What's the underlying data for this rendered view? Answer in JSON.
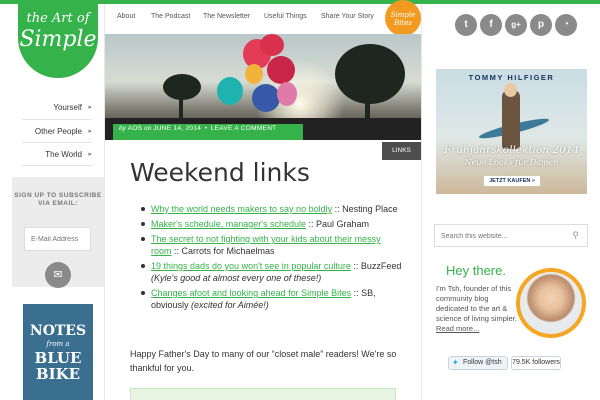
{
  "logo": {
    "line1": "the Art of",
    "line2": "Simple"
  },
  "left_nav": [
    {
      "label": "Yourself"
    },
    {
      "label": "Other People"
    },
    {
      "label": "The World"
    }
  ],
  "subscribe": {
    "title": "SIGN UP TO SUBSCRIBE VIA EMAIL:",
    "placeholder": "E-Mail Address"
  },
  "book": {
    "line1": "NOTES",
    "line2": "from a",
    "line3": "BLUE",
    "line4": "BIKE"
  },
  "top_nav": [
    {
      "label": "About"
    },
    {
      "label": "The Podcast"
    },
    {
      "label": "The Newsletter"
    },
    {
      "label": "Useful Things"
    },
    {
      "label": "Share Your Story"
    }
  ],
  "badge": {
    "line1": "Simple",
    "line2": "Bites"
  },
  "post": {
    "byline_prefix": "by",
    "author": "AOS",
    "date_prefix": "on",
    "date": "JUNE 14, 2014",
    "comment_link": "LEAVE A COMMENT",
    "category": "LINKS",
    "title": "Weekend links",
    "links": [
      {
        "link": "Why the world needs makers to say no boldly",
        "suffix": " :: Nesting Place",
        "note": ""
      },
      {
        "link": "Maker's schedule, manager's schedule",
        "suffix": " :: Paul Graham",
        "note": ""
      },
      {
        "link": "The secret to not fighting with your kids about their messy room",
        "suffix": " :: Carrots for Michaelmas",
        "note": ""
      },
      {
        "link": "19 things dads do you won't see in popular culture",
        "suffix": " :: BuzzFeed ",
        "note": "(Kyle's good at almost every one of these!)"
      },
      {
        "link": "Changes afoot and looking ahead for Simple Bites",
        "suffix": " :: SB, obviously ",
        "note": "(excited for Aimée!)"
      }
    ],
    "paragraph": "Happy Father's Day to many of our “closet male” readers! We're so thankful for you."
  },
  "social_icons": [
    {
      "icon": "twitter-icon",
      "glyph": "t"
    },
    {
      "icon": "facebook-icon",
      "glyph": "f"
    },
    {
      "icon": "googleplus-icon",
      "glyph": "g+"
    },
    {
      "icon": "pinterest-icon",
      "glyph": "p"
    },
    {
      "icon": "rss-icon",
      "glyph": "◔"
    }
  ],
  "ad": {
    "brand": "TOMMY HILFIGER",
    "headline": "Frühjahrskollektion 2014",
    "subline": "Neue Looks für Damen",
    "button": "JETZT KAUFEN »"
  },
  "search": {
    "placeholder": "Search this website..."
  },
  "about": {
    "greeting": "Hey there.",
    "bio": "I'm Tsh, founder of this community blog dedicated to the art & science of living simpler.",
    "more": "Read more...",
    "follow_label": "Follow @tsh",
    "followers": "79.5K followers"
  },
  "colors": {
    "accent": "#35b34a",
    "badge": "#f19a1f",
    "social": "#8a8a8a"
  }
}
